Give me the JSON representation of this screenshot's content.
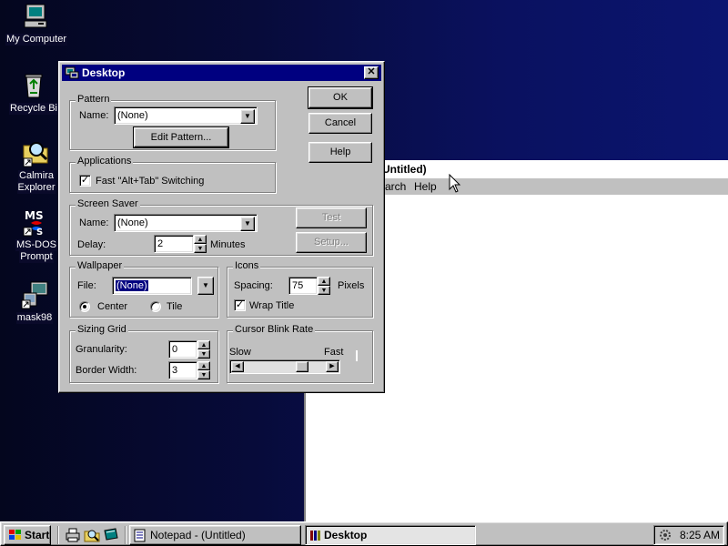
{
  "desktop": {
    "icons": [
      {
        "label": "My Computer",
        "icon": "computer-icon"
      },
      {
        "label": "Recycle Bi",
        "icon": "recycle-bin-icon"
      },
      {
        "label": "Calmira",
        "label2": "Explorer",
        "icon": "folder-magnifier-icon"
      },
      {
        "label": "MS-DOS",
        "label2": "Prompt",
        "icon": "msdos-icon"
      },
      {
        "label": "mask98",
        "icon": "mask98-icon"
      }
    ]
  },
  "notepad": {
    "title": "Untitled)",
    "menu": [
      "arch",
      "Help"
    ]
  },
  "dialog": {
    "title": "Desktop",
    "ok_label": "OK",
    "cancel_label": "Cancel",
    "help_label": "Help",
    "pattern": {
      "caption": "Pattern",
      "name_label": "Name:",
      "name_value": "(None)",
      "edit_label": "Edit Pattern..."
    },
    "applications": {
      "caption": "Applications",
      "fast_switch_label": "Fast \"Alt+Tab\" Switching",
      "fast_switch_checked": true
    },
    "screen_saver": {
      "caption": "Screen Saver",
      "name_label": "Name:",
      "name_value": "(None)",
      "delay_label": "Delay:",
      "delay_value": "2",
      "minutes_label": "Minutes",
      "test_label": "Test",
      "setup_label": "Setup..."
    },
    "wallpaper": {
      "caption": "Wallpaper",
      "file_label": "File:",
      "file_value": "(None)",
      "center_label": "Center",
      "tile_label": "Tile",
      "selected": "center"
    },
    "icons": {
      "caption": "Icons",
      "spacing_label": "Spacing:",
      "spacing_value": "75",
      "pixels_label": "Pixels",
      "wrap_label": "Wrap Title",
      "wrap_checked": true
    },
    "sizing_grid": {
      "caption": "Sizing Grid",
      "granularity_label": "Granularity:",
      "granularity_value": "0",
      "border_label": "Border Width:",
      "border_value": "3"
    },
    "cursor_blink": {
      "caption": "Cursor Blink Rate",
      "slow_label": "Slow",
      "fast_label": "Fast",
      "rate_fraction": 0.75
    }
  },
  "taskbar": {
    "start_label": "Start",
    "tasks": [
      {
        "label": "Notepad - (Untitled)",
        "active": false
      },
      {
        "label": "Desktop",
        "active": true
      }
    ],
    "clock": "8:25 AM"
  },
  "colors": {
    "titlebar": "#000080",
    "face": "#c0c0c0"
  }
}
